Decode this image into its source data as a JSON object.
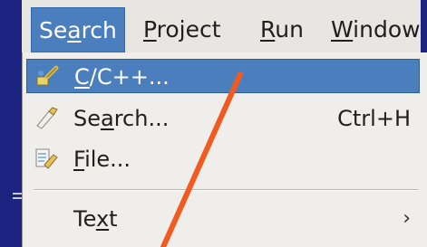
{
  "menubar": {
    "items": [
      {
        "label_pre": "Se",
        "label_u": "a",
        "label_post": "rch",
        "active": true
      },
      {
        "label_pre": "",
        "label_u": "P",
        "label_post": "roject",
        "active": false
      },
      {
        "label_pre": "",
        "label_u": "R",
        "label_post": "un",
        "active": false
      },
      {
        "label_pre": "",
        "label_u": "W",
        "label_post": "indow",
        "active": false
      }
    ]
  },
  "dropdown": {
    "items": [
      {
        "label_pre": "",
        "label_u": "C",
        "label_post": "/C++...",
        "accelerator": "",
        "icon": "cpp-search-icon",
        "selected": true
      },
      {
        "label_pre": "Se",
        "label_u": "a",
        "label_post": "rch...",
        "accelerator": "Ctrl+H",
        "icon": "search-flashlight-icon",
        "selected": false
      },
      {
        "label_pre": "",
        "label_u": "F",
        "label_post": "ile...",
        "accelerator": "",
        "icon": "file-search-icon",
        "selected": false
      },
      {
        "label_pre": "Te",
        "label_u": "x",
        "label_post": "t",
        "accelerator": "",
        "icon": "",
        "selected": false,
        "submenu": true
      }
    ],
    "submenu_arrow": "›"
  },
  "annotation": {
    "color": "#f25a1f"
  },
  "colors": {
    "selection": "#4a7ebd",
    "menu_bg": "#efeeea",
    "background": "#141c6e"
  }
}
